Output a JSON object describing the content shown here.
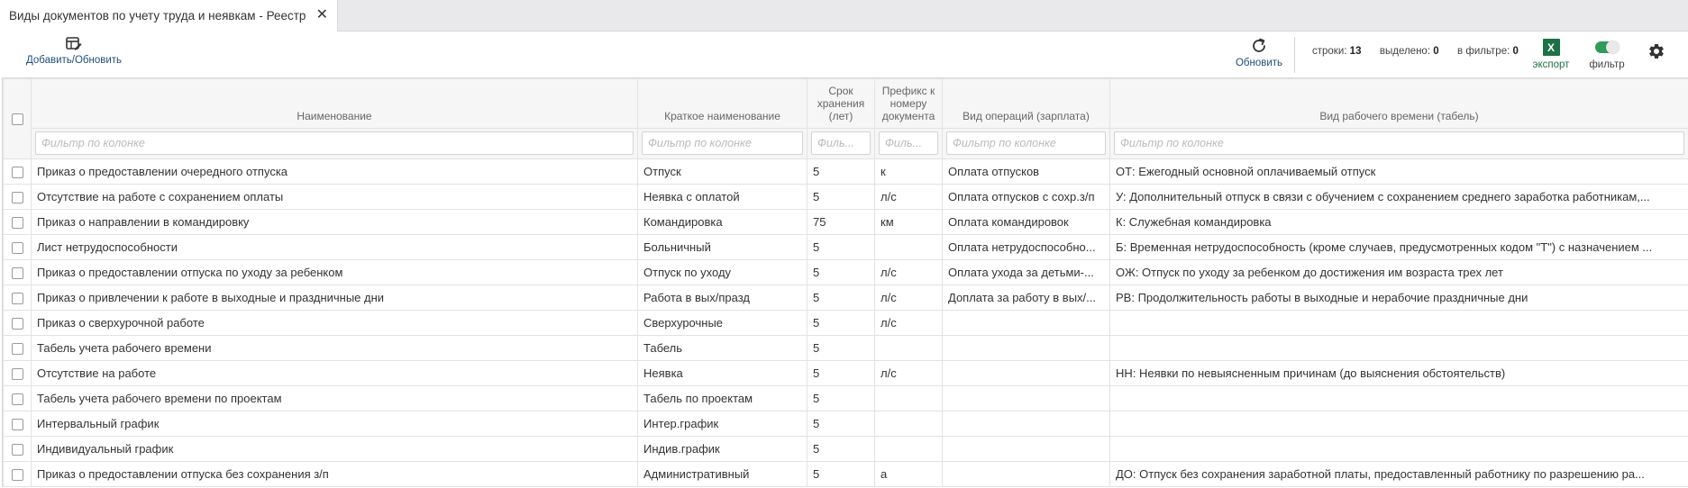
{
  "tab": {
    "title": "Виды документов по учету труда и неявкам - Реестр",
    "close": "✕"
  },
  "toolbar": {
    "add_label": "Добавить/Обновить",
    "refresh_label": "Обновить",
    "stats": {
      "rows_label": "строки:",
      "rows_value": "13",
      "selected_label": "выделено:",
      "selected_value": "0",
      "filtered_label": "в фильтре:",
      "filtered_value": "0"
    },
    "excel_icon_text": "X",
    "export_label": "экспорт",
    "filter_label": "фильтр",
    "filter_enabled": true,
    "accent_color": "#1f4e79",
    "excel_color": "#1e7145",
    "toggle_color": "#2e9b5a"
  },
  "table": {
    "columns": [
      {
        "label": "Наименование",
        "filter_placeholder": "Фильтр по колонке"
      },
      {
        "label": "Краткое наименование",
        "filter_placeholder": "Фильтр по колонке"
      },
      {
        "label": "Срок хранения (лет)",
        "filter_placeholder": "Филь..."
      },
      {
        "label": "Префикс к номеру документа",
        "filter_placeholder": "Филь..."
      },
      {
        "label": "Вид операций (зарплата)",
        "filter_placeholder": "Фильтр по колонке"
      },
      {
        "label": "Вид рабочего времени (табель)",
        "filter_placeholder": "Фильтр по колонке"
      }
    ],
    "rows": [
      [
        "Приказ о предоставлении очередного отпуска",
        "Отпуск",
        "5",
        "к",
        "Оплата отпусков",
        "ОТ: Ежегодный основной оплачиваемый отпуск"
      ],
      [
        "Отсутствие на работе с сохранением оплаты",
        "Неявка с оплатой",
        "5",
        "л/с",
        "Оплата отпусков с сохр.з/п",
        "У: Дополнительный отпуск в связи с обучением с сохранением среднего заработка работникам,..."
      ],
      [
        "Приказ о направлении в командировку",
        "Командировка",
        "75",
        "км",
        "Оплата командировок",
        "К: Служебная командировка"
      ],
      [
        "Лист нетрудоспособности",
        "Больничный",
        "5",
        "",
        "Оплата нетрудоспособно...",
        "Б: Временная нетрудоспособность (кроме случаев, предусмотренных кодом \"Т\") с назначением ..."
      ],
      [
        "Приказ о предоставлении отпуска по уходу за ребенком",
        "Отпуск по уходу",
        "5",
        "л/с",
        "Оплата ухода за детьми-...",
        "ОЖ: Отпуск по уходу за ребенком до достижения им возраста трех лет"
      ],
      [
        "Приказ о привлечении к работе в выходные и праздничные дни",
        "Работа в вых/празд",
        "5",
        "л/с",
        "Доплата за работу в вых/...",
        "РВ: Продолжительность работы в выходные и нерабочие праздничные дни"
      ],
      [
        "Приказ о сверхурочной работе",
        "Сверхурочные",
        "5",
        "л/с",
        "",
        ""
      ],
      [
        "Табель учета рабочего времени",
        "Табель",
        "5",
        "",
        "",
        ""
      ],
      [
        "Отсутствие на работе",
        "Неявка",
        "5",
        "л/с",
        "",
        "НН: Неявки по невыясненным причинам (до выяснения обстоятельств)"
      ],
      [
        "Табель учета рабочего времени по проектам",
        "Табель по проектам",
        "5",
        "",
        "",
        ""
      ],
      [
        "Интервальный график",
        "Интер.график",
        "5",
        "",
        "",
        ""
      ],
      [
        "Индивидуальный график",
        "Индив.график",
        "5",
        "",
        "",
        ""
      ],
      [
        "Приказ о предоставлении отпуска без сохранения з/п",
        "Административный",
        "5",
        "а",
        "",
        "ДО: Отпуск без сохранения заработной платы, предоставленный работнику по разрешению ра..."
      ]
    ]
  }
}
